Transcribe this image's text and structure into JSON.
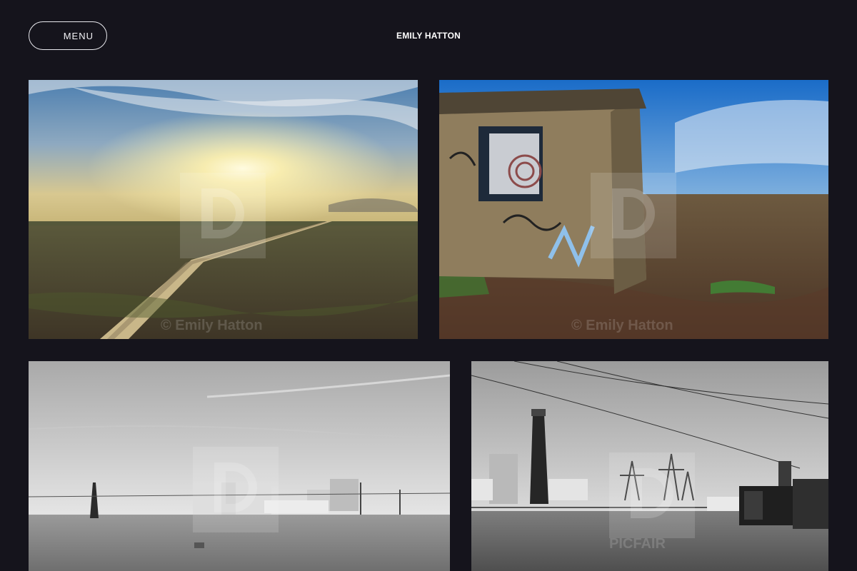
{
  "header": {
    "menu_label": "MENU",
    "site_title": "EMILY HATTON"
  },
  "gallery": [
    {
      "watermark": "© Emily Hatton"
    },
    {
      "watermark": "© Emily Hatton"
    },
    {
      "watermark": ""
    },
    {
      "watermark": "PICFAIR"
    }
  ],
  "colors": {
    "background": "#15141c",
    "text": "#ffffff",
    "button_border": "#e9e9ee"
  }
}
